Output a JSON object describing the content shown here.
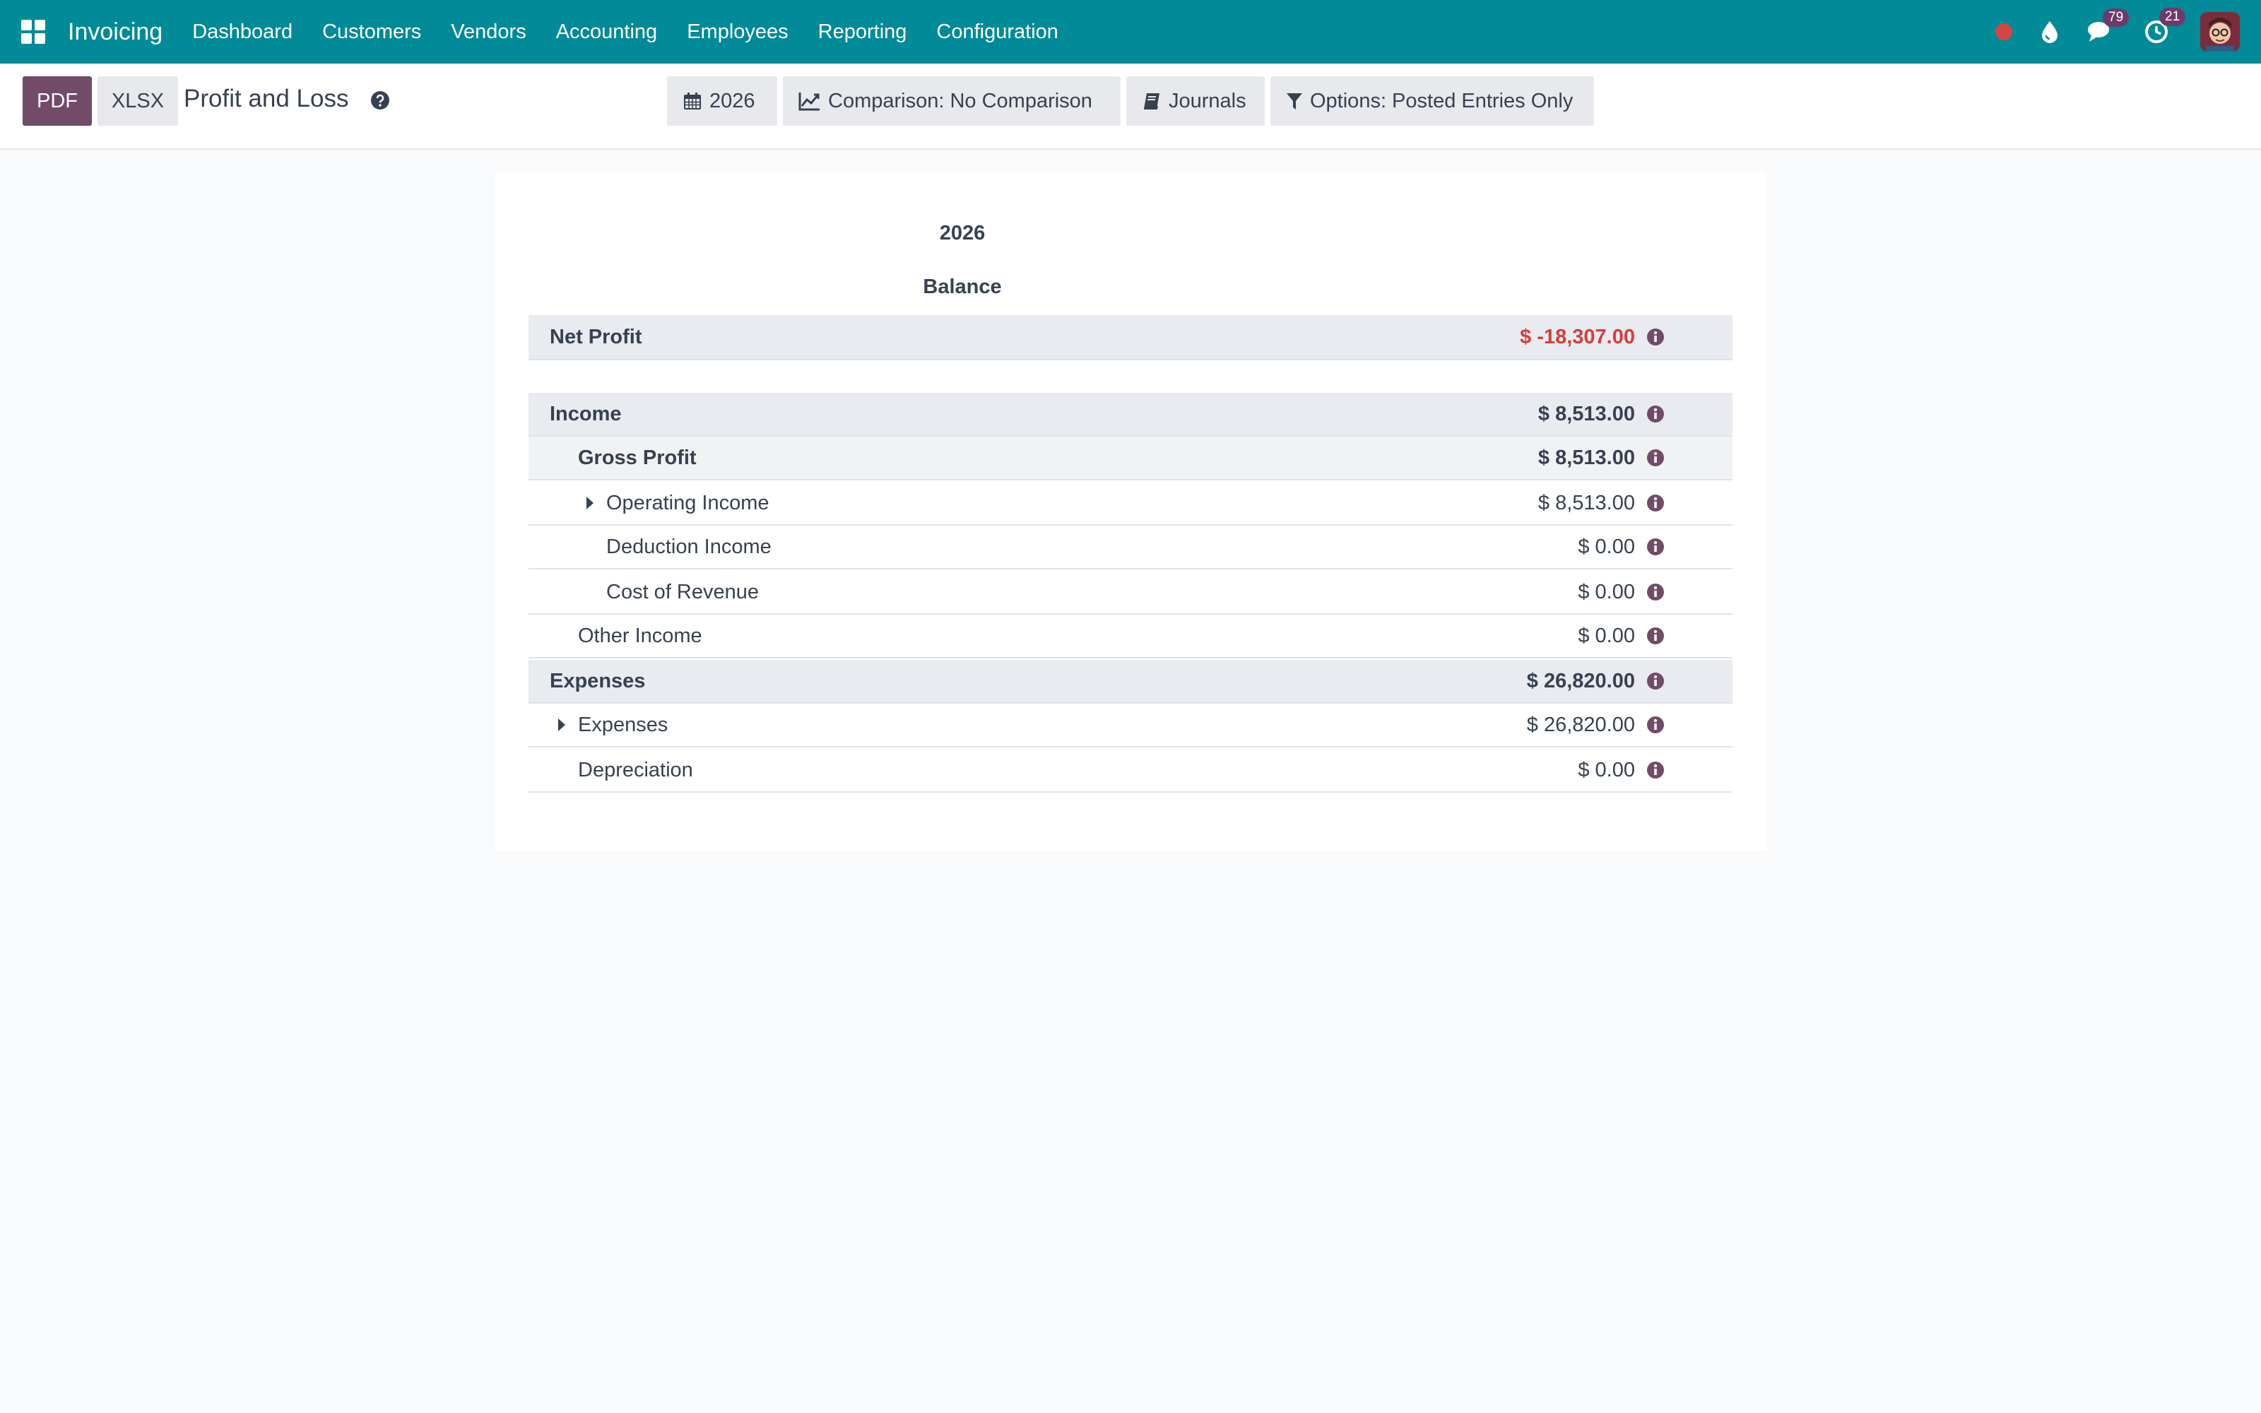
{
  "navbar": {
    "app_name": "Invoicing",
    "menu": [
      "Dashboard",
      "Customers",
      "Vendors",
      "Accounting",
      "Employees",
      "Reporting",
      "Configuration"
    ],
    "systray": {
      "messages_count": "79",
      "activities_count": "21"
    },
    "color": "#018a97"
  },
  "control_panel": {
    "pdf_label": "PDF",
    "xlsx_label": "XLSX",
    "title": "Profit and Loss",
    "filters": {
      "date": "2026",
      "comparison": "Comparison: No Comparison",
      "journals": "Journals",
      "options": "Options: Posted Entries Only"
    }
  },
  "report": {
    "column_year": "2026",
    "column_label": "Balance",
    "rows": [
      {
        "name": "Net Profit",
        "amount": "$ -18,307.00"
      },
      {
        "name": "Income",
        "amount": "$ 8,513.00"
      },
      {
        "name": "Gross Profit",
        "amount": "$ 8,513.00"
      },
      {
        "name": "Operating Income",
        "amount": "$ 8,513.00"
      },
      {
        "name": "Deduction Income",
        "amount": "$ 0.00"
      },
      {
        "name": "Cost of Revenue",
        "amount": "$ 0.00"
      },
      {
        "name": "Other Income",
        "amount": "$ 0.00"
      },
      {
        "name": "Expenses",
        "amount": "$ 26,820.00"
      },
      {
        "name": "Expenses",
        "amount": "$ 26,820.00"
      },
      {
        "name": "Depreciation",
        "amount": "$ 0.00"
      }
    ]
  },
  "colors": {
    "primary": "#714b67",
    "negative": "#d23f3a",
    "section_bg": "#e8ebef"
  }
}
